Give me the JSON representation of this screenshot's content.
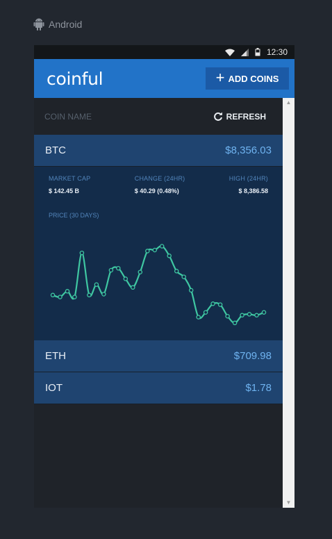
{
  "platform": {
    "label": "Android",
    "icon": "android-icon"
  },
  "statusbar": {
    "time": "12:30",
    "icons": [
      "wifi-icon",
      "signal-icon",
      "battery-icon"
    ]
  },
  "appbar": {
    "logo": "coinful",
    "add_coins_label": "ADD COINS",
    "add_icon": "plus-icon"
  },
  "table": {
    "column_name": "COIN NAME",
    "refresh_label": "REFRESH",
    "refresh_icon": "refresh-icon"
  },
  "coins": [
    {
      "symbol": "BTC",
      "price": "$8,356.03"
    },
    {
      "symbol": "ETH",
      "price": "$709.98"
    },
    {
      "symbol": "IOT",
      "price": "$1.78"
    }
  ],
  "details": {
    "market_cap_label": "MARKET CAP",
    "market_cap_value": "$ 142.45 B",
    "change_label": "CHANGE (24HR)",
    "change_value": "$ 40.29 (0.48%)",
    "high_label": "HIGH (24HR)",
    "high_value": "$ 8,386.58",
    "price_label": "PRICE (30 DAYS)"
  },
  "colors": {
    "accent": "#2273c8",
    "line": "#3fc7a2",
    "row": "#1f4470",
    "panel": "#132c4a",
    "price": "#6fb3f0"
  },
  "chart_data": {
    "type": "line",
    "title": "PRICE (30 DAYS)",
    "x": [
      1,
      2,
      3,
      4,
      5,
      6,
      7,
      8,
      9,
      10,
      11,
      12,
      13,
      14,
      15,
      16,
      17,
      18,
      19,
      20,
      21,
      22,
      23,
      24,
      25,
      26,
      27,
      28,
      29,
      30
    ],
    "series": [
      {
        "values": [
          0.32,
          0.3,
          0.36,
          0.3,
          0.76,
          0.32,
          0.43,
          0.33,
          0.58,
          0.6,
          0.49,
          0.4,
          0.56,
          0.78,
          0.79,
          0.83,
          0.73,
          0.57,
          0.51,
          0.37,
          0.09,
          0.14,
          0.23,
          0.22,
          0.1,
          0.03,
          0.11,
          0.12,
          0.11,
          0.14
        ]
      }
    ],
    "ylim": [
      0,
      1
    ],
    "grid": false,
    "legend": "none"
  }
}
